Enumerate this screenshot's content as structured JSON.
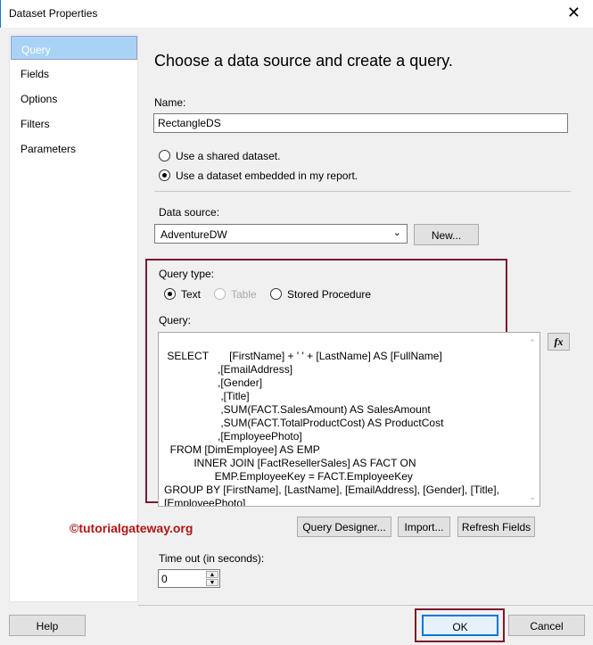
{
  "window": {
    "title": "Dataset Properties",
    "close_icon": "close-icon"
  },
  "sidebar": {
    "items": [
      {
        "label": "Query"
      },
      {
        "label": "Fields"
      },
      {
        "label": "Options"
      },
      {
        "label": "Filters"
      },
      {
        "label": "Parameters"
      }
    ]
  },
  "main": {
    "heading": "Choose a data source and create a query.",
    "name_label": "Name:",
    "name_value": "RectangleDS",
    "radio_shared": "Use a shared dataset.",
    "radio_embedded": "Use a dataset embedded in my report.",
    "datasource_label": "Data source:",
    "datasource_value": "AdventureDW",
    "new_button": "New...",
    "query_type_label": "Query type:",
    "qt_text": "Text",
    "qt_table": "Table",
    "qt_sp": "Stored Procedure",
    "query_label": "Query:",
    "query_text": "SELECT       [FirstName] + ' ' + [LastName] AS [FullName]\n                  ,[EmailAddress]\n                  ,[Gender]\n                   ,[Title]\n                   ,SUM(FACT.SalesAmount) AS SalesAmount\n                   ,SUM(FACT.TotalProductCost) AS ProductCost\n                  ,[EmployeePhoto]\n  FROM [DimEmployee] AS EMP\n          INNER JOIN [FactResellerSales] AS FACT ON\n                 EMP.EmployeeKey = FACT.EmployeeKey\nGROUP BY [FirstName], [LastName], [EmailAddress], [Gender], [Title],\n[EmployeePhoto]",
    "fx_button": "fx",
    "query_designer": "Query Designer...",
    "import": "Import...",
    "refresh": "Refresh Fields",
    "watermark": "©tutorialgateway.org",
    "timeout_label": "Time out (in seconds):",
    "timeout_value": "0"
  },
  "footer": {
    "help": "Help",
    "ok": "OK",
    "cancel": "Cancel"
  },
  "colors": {
    "highlight": "#7b1a2c",
    "selected": "#a9d3f5"
  }
}
